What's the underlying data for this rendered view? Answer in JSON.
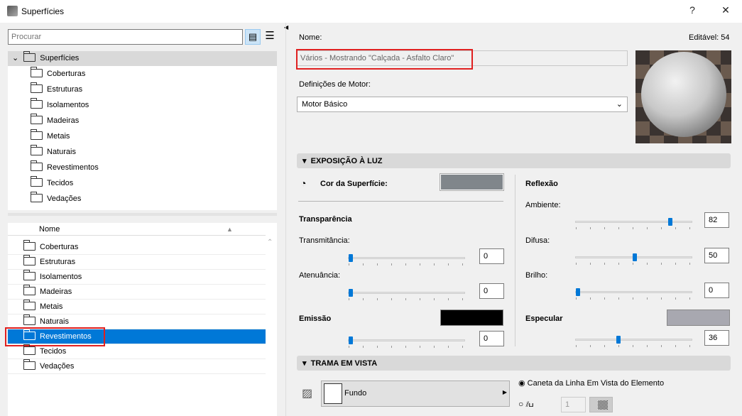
{
  "window": {
    "title": "Superfícies",
    "help": "?",
    "close": "✕"
  },
  "search": {
    "placeholder": "Procurar"
  },
  "tree": {
    "root": "Superfícies",
    "items": [
      "Coberturas",
      "Estruturas",
      "Isolamentos",
      "Madeiras",
      "Metais",
      "Naturais",
      "Revestimentos",
      "Tecidos",
      "Vedações"
    ]
  },
  "list": {
    "header": "Nome",
    "items": [
      "Coberturas",
      "Estruturas",
      "Isolamentos",
      "Madeiras",
      "Metais",
      "Naturais",
      "Revestimentos",
      "Tecidos",
      "Vedações"
    ],
    "selected": "Revestimentos"
  },
  "main": {
    "name_label": "Nome:",
    "editable": "Editável: 54",
    "name_value": "Vários - Mostrando \"Calçada - Asfalto Claro\"",
    "engine_label": "Definições de Motor:",
    "engine_value": "Motor Básico",
    "light_section": "EXPOSIÇÃO À LUZ",
    "surface_color_label": "Cor da Superfície:",
    "surface_color": "#80868b",
    "transparency": "Transparência",
    "transmittance_label": "Transmitância:",
    "transmittance": "0",
    "attenuation_label": "Atenuância:",
    "attenuation": "0",
    "emission_label": "Emissão",
    "emission_color": "#000000",
    "emission": "0",
    "reflection": "Reflexão",
    "ambient_label": "Ambiente:",
    "ambient": "82",
    "diffuse_label": "Difusa:",
    "diffuse": "50",
    "shine_label": "Brilho:",
    "shine": "0",
    "specular_label": "Especular",
    "specular_color": "#a8a8b0",
    "specular": "36",
    "hatch_section": "TRAMA EM VISTA",
    "background_label": "Fundo",
    "pen_option": "Caneta da Linha Em Vista do Elemento",
    "pen_number": "1"
  },
  "colors": {
    "accent": "#0078d7",
    "highlight": "#e02020"
  }
}
